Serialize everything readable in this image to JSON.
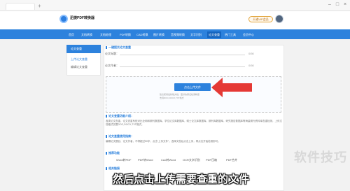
{
  "browser": {
    "new_tab_glyph": "+",
    "controls": [
      "–",
      "□",
      "×"
    ]
  },
  "header": {
    "logo_text": "迅捷PDF转换器",
    "vip_label": "开通VIP会员"
  },
  "nav": {
    "items": [
      "首页",
      "文档转换",
      "文档处理",
      "PDF转换",
      "CAD转换",
      "图片转换",
      "音视频转换",
      "文字识别",
      "论文查重",
      "热门工具",
      "会员中心"
    ],
    "active_index": 8
  },
  "sidebar": {
    "header": "论文查重",
    "items": [
      "上传论文查重",
      "编辑论文查重"
    ],
    "active_index": 0
  },
  "form": {
    "section_title": "一键提交论文查重",
    "title_label": "论文标题：",
    "author_label": "论文作者：",
    "title_count": "0/50",
    "author_count": "0/50"
  },
  "upload": {
    "button_label": "点击上传文件",
    "hint_lines": [
      "建议使用最新版文档，更好的保证检测精度",
      "支持DOC,DOCX,TXT格式"
    ]
  },
  "intro": {
    "title": "论文查重功能介绍：",
    "text": "各类论文查重，论文查重系统对比全网和期刊数据库，学位论文库数据库，硕士论文库数据库，期刊库数据库，研究报告数据库等海量期刊资料库查重检测，上传文档格式仅限DOC,DOCX,TXT格式。"
  },
  "howto": {
    "title": "论文查重使用指南：",
    "text": "编辑论文题目、论文作者，不得超过50字，点击“上传文件”，选择文档后点击上传，再点击开始检测即可。"
  },
  "recommend": {
    "title": "推荐功能",
    "tags": [
      "Word转PDF",
      "PDF转Word",
      "CAJ转Word",
      "OCR文字识别",
      "PDF压缩",
      "PDF合并"
    ]
  },
  "related": {
    "title": "相关链接"
  },
  "overlay": {
    "watermark": "软件技巧",
    "subtitle": "然后点击上传需要查重的文件"
  },
  "colors": {
    "primary": "#2d82dd",
    "arrow": "#e53935",
    "gold": "#e2a53c"
  }
}
